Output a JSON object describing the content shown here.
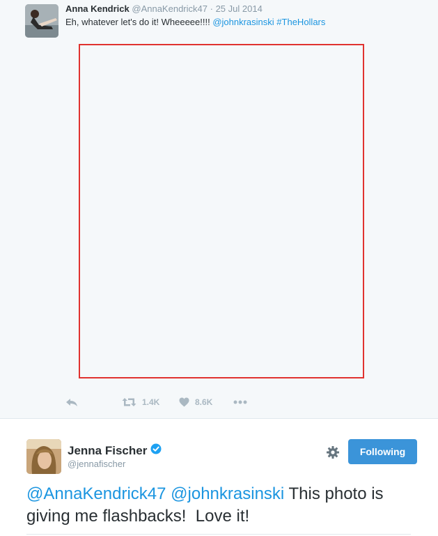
{
  "quoted_tweet": {
    "author_name": "Anna Kendrick",
    "author_handle": "@AnnaKendrick47",
    "date_separator": "·",
    "date": "25 Jul 2014",
    "text_plain": "Eh, whatever let's do it! Wheeeee!!!! ",
    "mention": "@johnkrasinski",
    "hashtag": "#TheHollars",
    "actions": {
      "retweet_count": "1.4K",
      "like_count": "8.6K"
    }
  },
  "reply_tweet": {
    "author_name": "Jenna Fischer",
    "author_handle": "@jennafischer",
    "follow_button_label": "Following",
    "mention_1": "@AnnaKendrick47",
    "mention_2": "@johnkrasinski",
    "text_rest": " This photo is giving me flashbacks!  Love it!"
  },
  "colors": {
    "link": "#1b95e0",
    "follow_button": "#3b94d9",
    "verified_badge": "#1da1f2",
    "media_frame_border": "#e0322f",
    "action_icons": "#aab8c2"
  },
  "icons": {
    "reply": "reply-icon",
    "retweet": "retweet-icon",
    "like": "heart-icon",
    "more": "more-dots-icon",
    "settings": "gear-icon",
    "verified": "verified-badge-icon"
  }
}
